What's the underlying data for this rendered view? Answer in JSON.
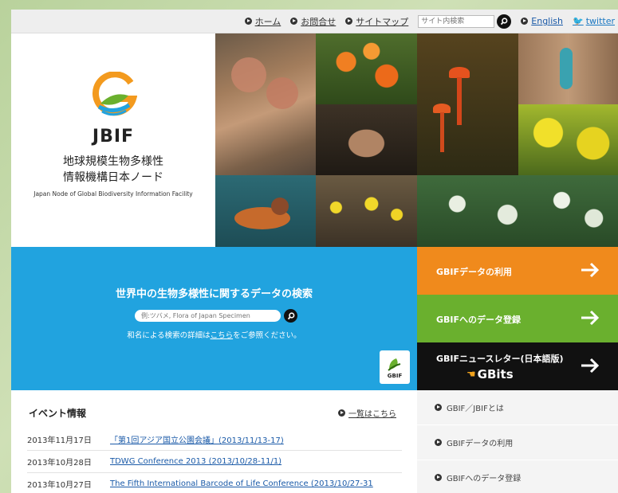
{
  "topnav": {
    "home": "ホーム",
    "contact": "お問合せ",
    "sitemap": "サイトマップ",
    "search_placeholder": "サイト内検索",
    "english": "English",
    "twitter": "twitter"
  },
  "logo": {
    "abbr": "JBIF",
    "name_line1": "地球規模生物多様性",
    "name_line2": "情報機構日本ノード",
    "name_en": "Japan Node of Global Biodiversity Information Facility"
  },
  "search_panel": {
    "title": "世界中の生物多様性に関するデータの検索",
    "placeholder": "例:ツバメ, Flora of Japan Specimen",
    "note_prefix": "和名による検索の詳細は",
    "note_link": "こちら",
    "note_suffix": "をご参照ください。",
    "badge_label": "GBIF"
  },
  "actions": [
    {
      "label": "GBIFデータの利用",
      "color": "#f08a1c"
    },
    {
      "label": "GBIFへのデータ登録",
      "color": "#6ab02e"
    },
    {
      "label": "GBIFニュースレター(日本語版)",
      "sub": "GBits",
      "color": "#111111"
    }
  ],
  "events": {
    "heading": "イベント情報",
    "more": "一覧はこちら",
    "items": [
      {
        "date": "2013年11月17日",
        "title": "「第1回アジア国立公園会議」(2013/11/13-17)"
      },
      {
        "date": "2013年10月28日",
        "title": "TDWG Conference 2013 (2013/10/28-11/1)"
      },
      {
        "date": "2013年10月27日",
        "title": "The Fifth International Barcode of Life Conference (2013/10/27-31"
      }
    ]
  },
  "side_menu": [
    {
      "label": "GBIF／JBIFとは"
    },
    {
      "label": "GBIFデータの利用"
    },
    {
      "label": "GBIFへのデータ登録"
    }
  ],
  "colors": {
    "blue_panel": "#21a3df",
    "orange": "#f08a1c",
    "green": "#6ab02e",
    "black": "#111111",
    "link": "#1a5aa8"
  }
}
